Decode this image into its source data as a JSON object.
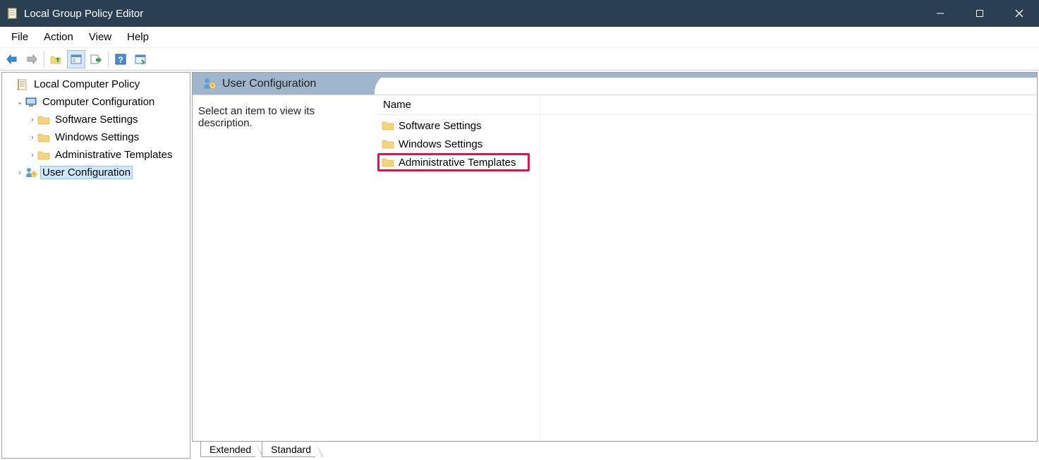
{
  "window": {
    "title": "Local Group Policy Editor"
  },
  "menu": {
    "items": [
      "File",
      "Action",
      "View",
      "Help"
    ]
  },
  "tree": {
    "root": {
      "label": "Local Computer Policy"
    },
    "computer_config": {
      "label": "Computer Configuration"
    },
    "cc_children": [
      {
        "label": "Software Settings"
      },
      {
        "label": "Windows Settings"
      },
      {
        "label": "Administrative Templates"
      }
    ],
    "user_config": {
      "label": "User Configuration"
    }
  },
  "content": {
    "header_title": "User Configuration",
    "description": "Select an item to view its description.",
    "column_header": "Name",
    "items": [
      {
        "label": "Software Settings"
      },
      {
        "label": "Windows Settings"
      },
      {
        "label": "Administrative Templates"
      }
    ]
  },
  "tabs": {
    "extended": "Extended",
    "standard": "Standard"
  }
}
